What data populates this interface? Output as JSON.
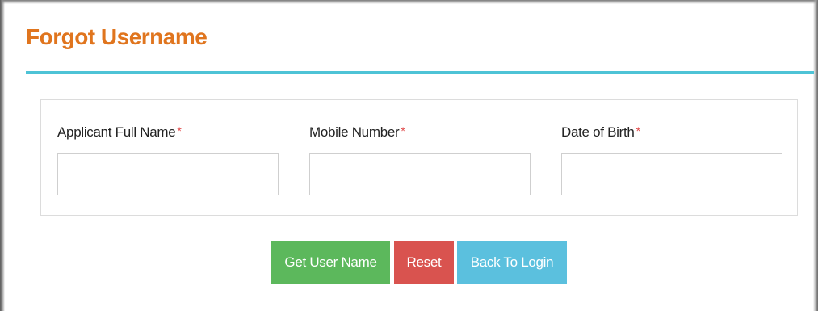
{
  "page": {
    "title": "Forgot Username"
  },
  "form": {
    "fields": [
      {
        "label": "Applicant Full Name",
        "required_marker": "*",
        "value": "",
        "placeholder": ""
      },
      {
        "label": "Mobile Number",
        "required_marker": "*",
        "value": "",
        "placeholder": ""
      },
      {
        "label": "Date of Birth",
        "required_marker": "*",
        "value": "",
        "placeholder": ""
      }
    ]
  },
  "actions": {
    "get_username_label": "Get User Name",
    "reset_label": "Reset",
    "back_to_login_label": "Back To Login"
  },
  "colors": {
    "title": "#e0751e",
    "rule": "#4ec3d6",
    "required": "#e04848",
    "btn_get": "#5cb85c",
    "btn_reset": "#d9534f",
    "btn_back": "#5bc0de"
  }
}
